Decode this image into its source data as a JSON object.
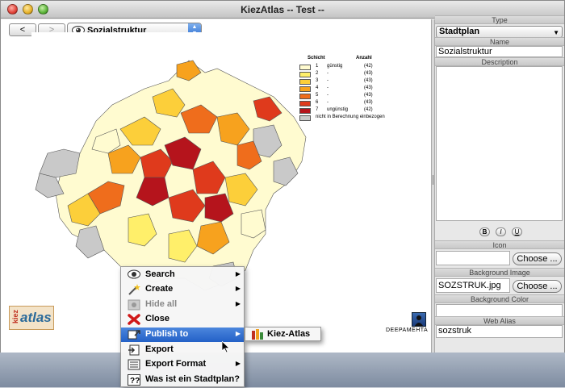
{
  "window": {
    "title": "KiezAtlas -- Test --"
  },
  "toolbar": {
    "back_label": "<",
    "forward_label": ">",
    "view_selected": "Sozialstruktur"
  },
  "map": {
    "legend": {
      "header_schicht": "Schicht",
      "header_anzahl": "Anzahl",
      "rows": [
        {
          "n": "1",
          "text": "günstig",
          "count": "(42)",
          "color": "#fffbd0"
        },
        {
          "n": "2",
          "text": "-",
          "count": "(43)",
          "color": "#ffef6a"
        },
        {
          "n": "3",
          "text": "-",
          "count": "(43)",
          "color": "#fccf3a"
        },
        {
          "n": "4",
          "text": "-",
          "count": "(43)",
          "color": "#f7a21e"
        },
        {
          "n": "5",
          "text": "-",
          "count": "(43)",
          "color": "#ef6d1c"
        },
        {
          "n": "6",
          "text": "-",
          "count": "(43)",
          "color": "#df3a1c"
        },
        {
          "n": "7",
          "text": "ungünstig",
          "count": "(42)",
          "color": "#b5141c"
        }
      ],
      "other_label": "nicht in Berechnung einbezogen",
      "other_color": "#c9c9c9"
    },
    "logo_kiez": "kiez",
    "logo_atlas": "atlas",
    "deepamehta_label": "DEEPAMEHTA"
  },
  "properties": {
    "type_label": "Type",
    "type_value": "Stadtplan",
    "name_label": "Name",
    "name_value": "Sozialstruktur",
    "description_label": "Description",
    "bold_label": "B",
    "italic_label": "I",
    "underline_label": "U",
    "icon_label": "Icon",
    "icon_value": "",
    "choose_label": "Choose ...",
    "background_image_label": "Background Image",
    "background_image_value": "SOZSTRUK.jpg",
    "background_color_label": "Background Color",
    "background_color_value": "",
    "web_alias_label": "Web Alias",
    "web_alias_value": "sozstruk"
  },
  "context_menu": {
    "items": [
      {
        "label": "Search",
        "has_submenu": true
      },
      {
        "label": "Create",
        "has_submenu": true
      },
      {
        "label": "Hide all",
        "has_submenu": true,
        "disabled": true
      },
      {
        "label": "Close",
        "has_submenu": false
      },
      {
        "label": "Publish to",
        "has_submenu": true,
        "selected": true
      },
      {
        "label": "Export",
        "has_submenu": false
      },
      {
        "label": "Export Format",
        "has_submenu": true
      },
      {
        "label": "Was ist ein Stadtplan?",
        "has_submenu": false
      }
    ],
    "submenu_arrow": "▶"
  },
  "submenu": {
    "label": "Kiez-Atlas"
  }
}
